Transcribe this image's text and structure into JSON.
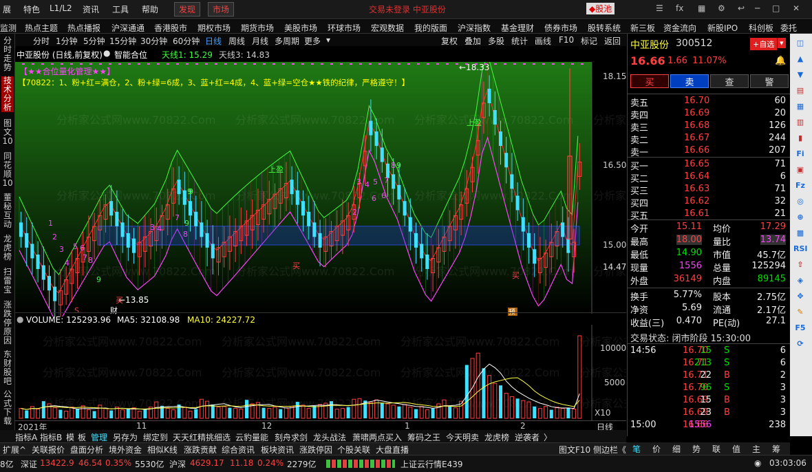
{
  "menubar": {
    "items": [
      "展",
      "特色",
      "L1/L2",
      "资讯",
      "工具",
      "帮助",
      "发现",
      "市场"
    ],
    "center_title": "交易未登录 中亚股份",
    "guchi": "股池"
  },
  "navbar": {
    "items": [
      "监测",
      "热点主题",
      "热点播报",
      "沪深通通",
      "香港股市",
      "期权市场",
      "期货市场",
      "美股市场",
      "环球市场",
      "宏观数据",
      "我的版面",
      "沪深指数",
      "基金理财",
      "债券市场",
      "股转系统",
      "新三板",
      "资金流向",
      "新股IPO",
      "科创板",
      "委托"
    ]
  },
  "leftbar": {
    "tabs": [
      "分时走势",
      "技术分析",
      "图文10",
      "同花顺10",
      "董秘互动",
      "龙虎榜",
      "扫雷宝",
      "涨跌停原因",
      "东财股吧",
      "公式下载"
    ]
  },
  "periods": [
    "分时",
    "1分钟",
    "5分钟",
    "15分钟",
    "30分钟",
    "60分钟",
    "日线",
    "周线",
    "月线",
    "多周期",
    "更多"
  ],
  "toolbar_right": [
    "复权",
    "叠加",
    "多股",
    "统计",
    "画线",
    "F10",
    "标记",
    "返回"
  ],
  "chart": {
    "title": "中亚股份 (日线,前复权)",
    "indicator": "智能合位",
    "line1_label": "天线1: 15.29",
    "line3_label": "天线3: 14.83",
    "banner": "【★★合位量化管理★★】",
    "rule": "【70822：1、粉+红=满仓，2、粉+绿=6成，3、蓝+红=4成，4、蓝+绿=空仓★★铁的纪律，严格遵守！】",
    "watermark": "分析家公式网www.70822.Com",
    "high_label": "18.33",
    "low_label": "13.85",
    "yaxis": [
      "18.15",
      "16.50",
      "15.00",
      "14.47"
    ],
    "xaxis": [
      "2021年",
      "11",
      "12",
      "1",
      "2"
    ],
    "markers": {
      "shangying1": "上盈",
      "shangying2": "上盈",
      "mai1": "买",
      "mai2": "买",
      "mai3": "买",
      "yu": "预",
      "cai": "财",
      "s": "S"
    },
    "seq_labels": [
      "1",
      "2",
      "3",
      "4",
      "5",
      "6",
      "7",
      "8",
      "9"
    ]
  },
  "volume": {
    "label": "VOLUME: 125293.96",
    "ma5": "MA5: 32108.98",
    "ma10": "MA10: 24227.72",
    "yaxis": [
      "10000",
      "5000",
      "X10"
    ],
    "bars": [
      1500,
      1200,
      1800,
      1400,
      2600,
      2200,
      1600,
      1300,
      1100,
      1700,
      1400,
      1900,
      1300,
      1100,
      2000,
      1500,
      1200,
      1700,
      1300,
      1400,
      1600,
      1100,
      1300,
      1700,
      2500,
      1900,
      1500,
      1300,
      2100,
      1700,
      1100,
      1400,
      2900,
      2600,
      2100,
      1700,
      1800,
      1600,
      1500,
      1400,
      2800,
      2200,
      2400,
      1600,
      1500,
      1700,
      1400,
      1600,
      1800,
      2500,
      2000,
      1500,
      1900,
      2100,
      2300,
      2600,
      1400,
      1500,
      1700,
      2900,
      3000,
      2700,
      2400,
      2800,
      2300,
      2200,
      2000,
      1800,
      2100,
      1700,
      1400,
      1800,
      1300,
      1500,
      2200,
      2800,
      1800,
      1600,
      2600,
      8100,
      9100,
      9900,
      7600,
      6500,
      5300,
      5000,
      3800,
      3300,
      3000,
      2700,
      2500,
      1800,
      1500,
      1800,
      1300,
      1700,
      1500,
      1600,
      1400,
      12529
    ]
  },
  "right": {
    "stock_name": "中亚股份",
    "stock_code": "300512",
    "add_fav": "+自选",
    "price": "16.66",
    "change": "1.66",
    "pct": "11.07%",
    "buttons": [
      "买",
      "卖",
      "查",
      "警"
    ],
    "asks": [
      {
        "l": "卖五",
        "p": "16.70",
        "v": "60"
      },
      {
        "l": "卖四",
        "p": "16.69",
        "v": "20"
      },
      {
        "l": "卖三",
        "p": "16.68",
        "v": "126"
      },
      {
        "l": "卖二",
        "p": "16.67",
        "v": "244"
      },
      {
        "l": "卖一",
        "p": "16.66",
        "v": "207"
      }
    ],
    "bids": [
      {
        "l": "买一",
        "p": "16.65",
        "v": "71"
      },
      {
        "l": "买二",
        "p": "16.64",
        "v": "6"
      },
      {
        "l": "买三",
        "p": "16.63",
        "v": "71"
      },
      {
        "l": "买四",
        "p": "16.62",
        "v": "32"
      },
      {
        "l": "买五",
        "p": "16.61",
        "v": "21"
      }
    ],
    "stats": [
      [
        "今开",
        "15.11",
        "均价",
        "17.29"
      ],
      [
        "最高",
        "18.00",
        "量比",
        "13.74"
      ],
      [
        "最低",
        "14.90",
        "市值",
        "45.7亿"
      ],
      [
        "现量",
        "1556",
        "总量",
        "125294"
      ],
      [
        "外盘",
        "36149",
        "内盘",
        "89145"
      ]
    ],
    "stats2": [
      [
        "换手",
        "5.77%",
        "股本",
        "2.75亿"
      ],
      [
        "净资",
        "5.69",
        "流通",
        "2.17亿"
      ],
      [
        "收益(三)",
        "0.470",
        "PE(动)",
        "27.1"
      ]
    ],
    "trade_status": "交易状态: 闭市阶段 15:30:00",
    "ticks": [
      [
        "14:56",
        "16.70",
        "15",
        "S",
        "6"
      ],
      [
        "",
        "16.71",
        "213",
        "S",
        "6"
      ],
      [
        "",
        "16.71",
        "22",
        "B",
        "2"
      ],
      [
        "",
        "16.70",
        "96",
        "S",
        "3"
      ],
      [
        "",
        "16.69",
        "15",
        "B",
        "3"
      ],
      [
        "",
        "16.69",
        "23",
        "B",
        "3"
      ],
      [
        "15:00",
        "16.66",
        "1556",
        "",
        "238"
      ]
    ],
    "bottom_tabs": [
      "笔",
      "价",
      "细",
      "势",
      "联",
      "值",
      "主",
      "筹"
    ]
  },
  "bottom_tabs": [
    "指标A",
    "指标B",
    "模",
    "板",
    "管理",
    "另存为",
    "绑定到",
    "天天红精挑细选",
    "云豹量能",
    "刻舟求剑",
    "龙头战法",
    "萧啸两点买入",
    "筹码之王",
    "今天明卖",
    "龙虎榜",
    "逆袭者"
  ],
  "status1": [
    "扩展^",
    "关联报价",
    "盘面分析",
    "境外资金",
    "相似K线",
    "涨跌贡献",
    "综合资讯",
    "板块资讯",
    "涨跌停因",
    "个股关联",
    "大盘直播"
  ],
  "status1_right": "图文F10 侧边栏《",
  "status2": {
    "index1_name": "深证",
    "index1_val": "13422.9",
    "index1_chg": "46.54",
    "index1_pct": "0.35%",
    "index1_amt": "5530亿",
    "index2_name": "沪深",
    "index2_val": "4629.17",
    "index2_chg": "11.18",
    "index2_pct": "0.24%",
    "index2_amt": "2279亿",
    "prefix": "8亿",
    "ticker": "上证云行情E439",
    "time": "03:03:06"
  },
  "colors": {
    "red": "#ff4040",
    "green": "#00e000",
    "cyan": "#40e0ff",
    "magenta": "#ff40ff",
    "yellow": "#ffff40"
  }
}
